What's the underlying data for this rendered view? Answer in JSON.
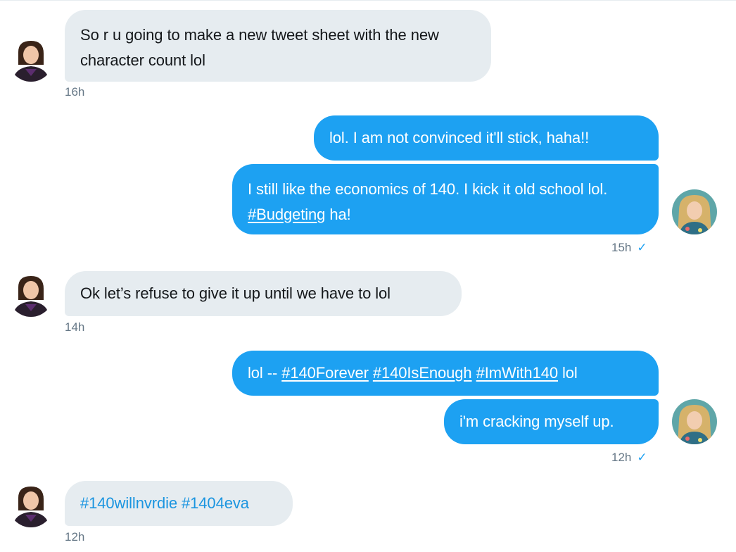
{
  "messages": [
    {
      "direction": "in",
      "text": "So r u going to make a new tweet sheet with the new character count lol",
      "time": "16h"
    },
    {
      "direction": "out",
      "text": "lol.  I am not convinced it'll stick, haha!!"
    },
    {
      "direction": "out",
      "text_before": "I still like the economics of 140. I kick it old school lol.  ",
      "hashtag": "#Budgeting",
      "text_after": " ha!",
      "time": "15h"
    },
    {
      "direction": "in",
      "text": "Ok let’s refuse to give it up until we have to lol",
      "time": "14h"
    },
    {
      "direction": "out",
      "prefix": "lol -- ",
      "hashtags": [
        "#140Forever",
        "#140IsEnough",
        "#ImWith140"
      ],
      "suffix": " lol"
    },
    {
      "direction": "out",
      "text": "i'm cracking myself up.",
      "time": "12h"
    },
    {
      "direction": "in",
      "text": "#140willnvrdie #1404eva",
      "time": "12h"
    }
  ],
  "read_receipt_icon": "check-icon",
  "colors": {
    "incoming_bubble": "#e6ecf0",
    "outgoing_bubble": "#1da1f2",
    "timestamp": "#657786",
    "hashtag": "#1b95e0"
  }
}
